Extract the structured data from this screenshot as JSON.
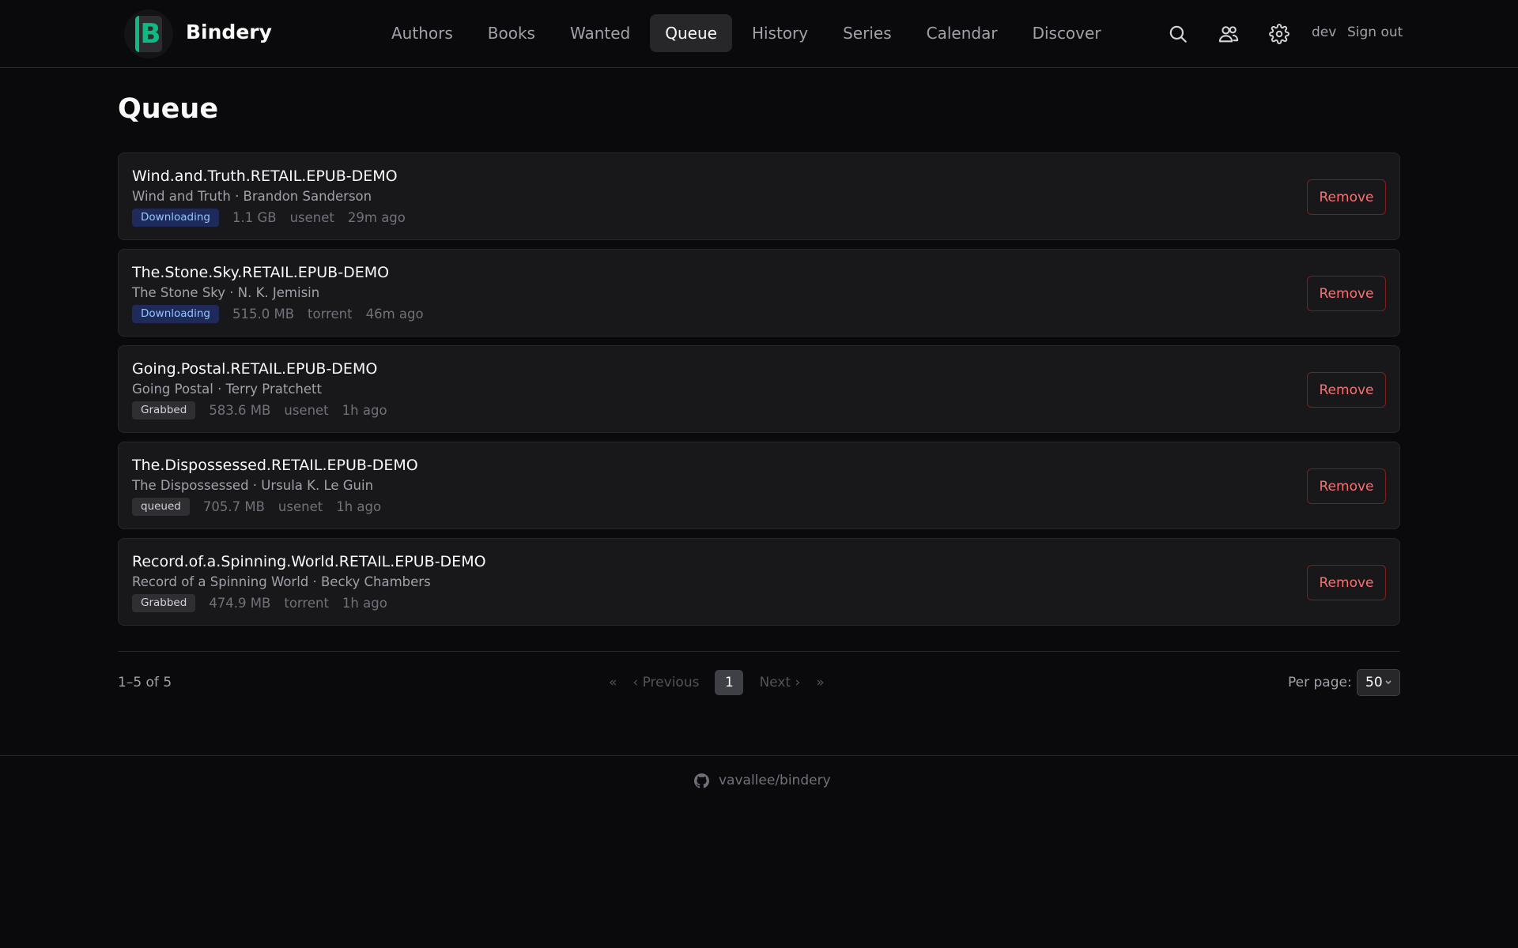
{
  "app": {
    "brand": "Bindery",
    "logo_letter": "B"
  },
  "nav": {
    "items": [
      {
        "label": "Authors"
      },
      {
        "label": "Books"
      },
      {
        "label": "Wanted"
      },
      {
        "label": "Queue",
        "active": true
      },
      {
        "label": "History"
      },
      {
        "label": "Series"
      },
      {
        "label": "Calendar"
      },
      {
        "label": "Discover"
      }
    ]
  },
  "header": {
    "icons": [
      "search-icon",
      "users-icon",
      "gear-icon"
    ],
    "user": "dev",
    "sign_out": "Sign out"
  },
  "page": {
    "title": "Queue"
  },
  "queue": [
    {
      "release": "Wind.and.Truth.RETAIL.EPUB-DEMO",
      "subtitle": "Wind and Truth · Brandon Sanderson",
      "status": "Downloading",
      "size": "1.1 GB",
      "protocol": "usenet",
      "age": "29m ago",
      "action": "Remove"
    },
    {
      "release": "The.Stone.Sky.RETAIL.EPUB-DEMO",
      "subtitle": "The Stone Sky · N. K. Jemisin",
      "status": "Downloading",
      "size": "515.0 MB",
      "protocol": "torrent",
      "age": "46m ago",
      "action": "Remove"
    },
    {
      "release": "Going.Postal.RETAIL.EPUB-DEMO",
      "subtitle": "Going Postal · Terry Pratchett",
      "status": "Grabbed",
      "size": "583.6 MB",
      "protocol": "usenet",
      "age": "1h ago",
      "action": "Remove"
    },
    {
      "release": "The.Dispossessed.RETAIL.EPUB-DEMO",
      "subtitle": "The Dispossessed · Ursula K. Le Guin",
      "status": "queued",
      "size": "705.7 MB",
      "protocol": "usenet",
      "age": "1h ago",
      "action": "Remove"
    },
    {
      "release": "Record.of.a.Spinning.World.RETAIL.EPUB-DEMO",
      "subtitle": "Record of a Spinning World · Becky Chambers",
      "status": "Grabbed",
      "size": "474.9 MB",
      "protocol": "torrent",
      "age": "1h ago",
      "action": "Remove"
    }
  ],
  "pagination": {
    "range": "1–5 of 5",
    "first": "«",
    "previous": "‹ Previous",
    "current_page": "1",
    "next": "Next ›",
    "last": "»",
    "per_page_label": "Per page:",
    "per_page_value": "50"
  },
  "footer": {
    "repo": "vavallee/bindery",
    "icon": "github-icon"
  },
  "colors": {
    "background": "#0a0a0c",
    "accent": "#10b981",
    "danger": "#f87171",
    "badge_downloading": "#1e2a5a"
  }
}
